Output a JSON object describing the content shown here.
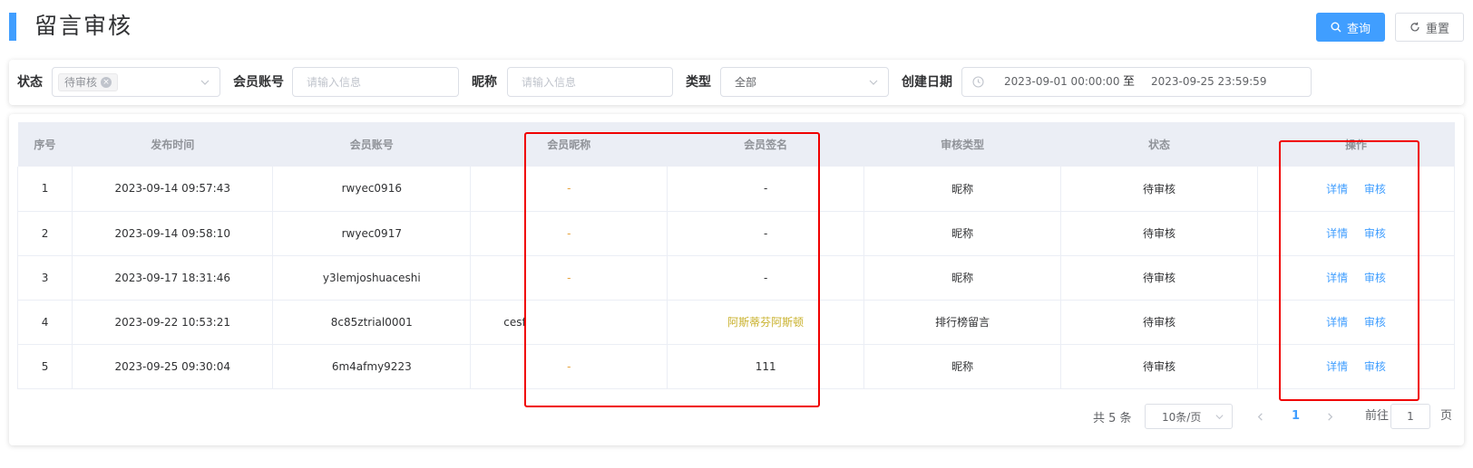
{
  "header": {
    "title": "留言审核",
    "search_label": "查询",
    "reset_label": "重置"
  },
  "filters": {
    "status_label": "状态",
    "status_tag": "待审核",
    "account_label": "会员账号",
    "account_placeholder": "请输入信息",
    "nickname_label": "昵称",
    "nickname_placeholder": "请输入信息",
    "type_label": "类型",
    "type_value": "全部",
    "date_label": "创建日期",
    "date_start": "2023-09-01 00:00:00",
    "date_sep": "至",
    "date_end": "2023-09-25 23:59:59"
  },
  "table": {
    "columns": [
      "序号",
      "发布时间",
      "会员账号",
      "会员昵称",
      "会员签名",
      "审核类型",
      "状态",
      "操作"
    ],
    "rows": [
      {
        "index": "1",
        "time": "2023-09-14 09:57:43",
        "account": "rwyec0916",
        "nickname": "-",
        "signature": "-",
        "type": "昵称",
        "status": "待审核"
      },
      {
        "index": "2",
        "time": "2023-09-14 09:58:10",
        "account": "rwyec0917",
        "nickname": "-",
        "signature": "-",
        "type": "昵称",
        "status": "待审核"
      },
      {
        "index": "3",
        "time": "2023-09-17 18:31:46",
        "account": "y3lemjoshuaceshi",
        "nickname": "-",
        "signature": "-",
        "type": "昵称",
        "status": "待审核"
      },
      {
        "index": "4",
        "time": "2023-09-22 10:53:21",
        "account": "8c85ztrial0001",
        "nickname": "cesf",
        "signature": "阿斯蒂芬阿斯顿",
        "type": "排行榜留言",
        "status": "待审核"
      },
      {
        "index": "5",
        "time": "2023-09-25 09:30:04",
        "account": "6m4afmy9223",
        "nickname": "-",
        "signature": "111",
        "type": "昵称",
        "status": "待审核"
      }
    ],
    "op_detail": "详情",
    "op_review": "审核"
  },
  "pagination": {
    "total": "共 5 条",
    "page_size": "10条/页",
    "current_page": "1",
    "goto_label": "前往",
    "goto_value": "1",
    "page_suffix": "页"
  },
  "colors": {
    "accent": "#409eff",
    "highlight": "#f00000",
    "dash_yellow": "#e6a23c",
    "signature_yellow": "#c9b12c"
  }
}
